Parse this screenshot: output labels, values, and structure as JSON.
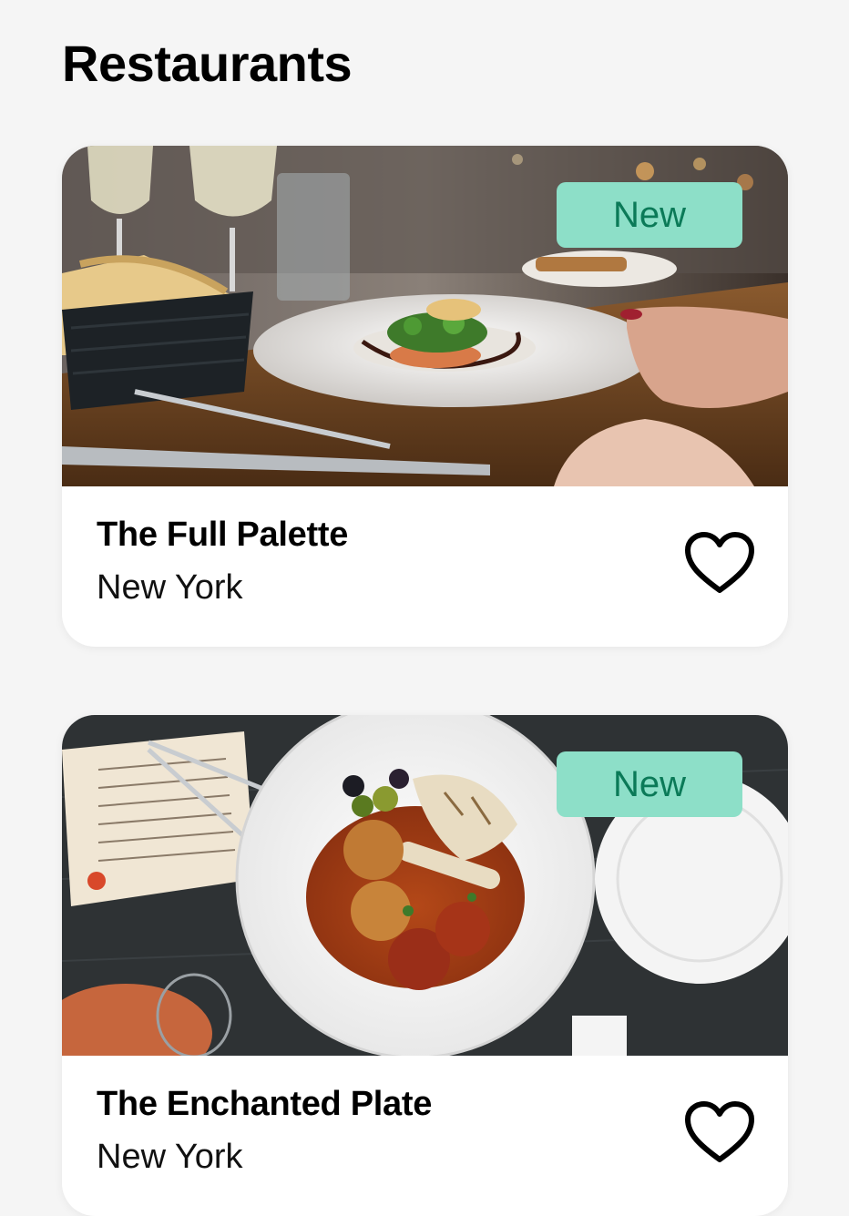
{
  "header": {
    "title": "Restaurants"
  },
  "restaurants": [
    {
      "name": "The Full Palette",
      "city": "New York",
      "badge": "New",
      "favorite_icon": "heart-outline-icon",
      "image": "restaurant-table-plated-dish"
    },
    {
      "name": "The Enchanted Plate",
      "city": "New York",
      "badge": "New",
      "favorite_icon": "heart-outline-icon",
      "image": "overhead-plate-meatballs-calamari"
    }
  ],
  "colors": {
    "background": "#f5f5f5",
    "card": "#ffffff",
    "badge_bg": "#8ddfc8",
    "badge_text": "#0b7a58",
    "text": "#000000"
  }
}
